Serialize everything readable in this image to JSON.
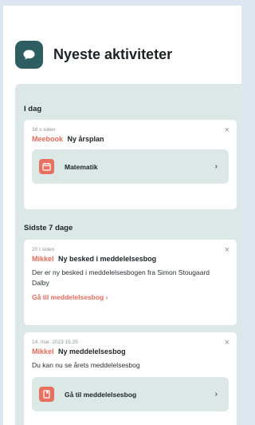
{
  "header": {
    "title": "Nyeste aktiviteter",
    "icon": "chat-bubble-icon"
  },
  "colors": {
    "accent": "#e36b5b",
    "brand": "#2e5e62",
    "feed_bg": "#dce8e6"
  },
  "sections": [
    {
      "label": "I dag",
      "cards": [
        {
          "time": "38 s siden",
          "sender": "Meebook",
          "subject": "Ny årsplan",
          "action": {
            "label": "Matematik",
            "icon": "calendar-icon"
          }
        }
      ]
    },
    {
      "label": "Sidste 7 dage",
      "cards": [
        {
          "time": "20 t siden",
          "sender": "Mikkel",
          "subject": "Ny besked i meddelelsesbog",
          "body": "Der er ny besked i meddelelsesbogen fra Simon Stougaard Dalby",
          "link": "Gå til meddelelsesbog ›"
        },
        {
          "time": "14. mar. 2023 15.25",
          "sender": "Mikkel",
          "subject": "Ny meddelelsesbog",
          "body": "Du kan nu se årets meddelelsesbog",
          "action": {
            "label": "Gå til meddelelsesbog",
            "icon": "notebook-icon"
          }
        }
      ]
    }
  ],
  "close_glyph": "×",
  "chevron_glyph": "›"
}
